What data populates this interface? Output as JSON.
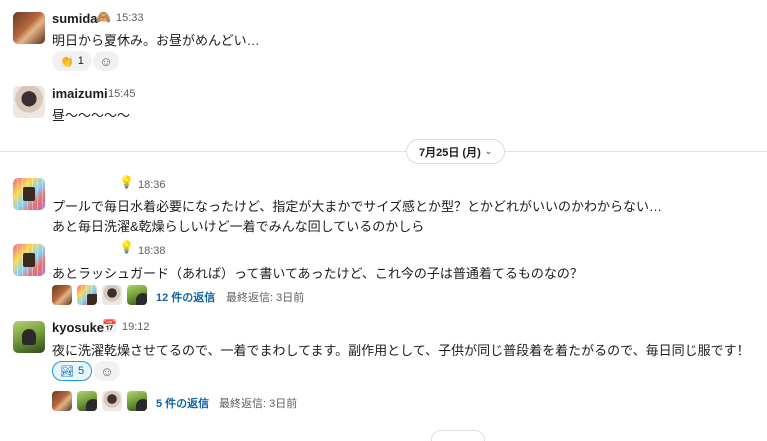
{
  "messages": [
    {
      "user": "sumida",
      "status_emoji": "status-emoji-icon",
      "time": "15:33",
      "text": "明日から夏休み。お昼がめんどい…",
      "reactions": [
        {
          "emoji": "reaction-emoji-icon",
          "count": "1"
        }
      ]
    },
    {
      "user": "imaizumi",
      "time": "15:45",
      "text": "昼〜〜〜〜〜"
    },
    {
      "user": "",
      "status_emoji": "lightbulb-icon",
      "time": "18:36",
      "text_lines": [
        "プールで毎日水着必要になったけど、指定が大まかでサイズ感とか型？とかどれがいいのかわからない…",
        "あと毎日洗濯&乾燥らしいけど一着でみんな回しているのかしら"
      ]
    },
    {
      "user": "",
      "status_emoji": "lightbulb-icon",
      "time": "18:38",
      "text": "あとラッシュガード（あれば）って書いてあったけど、これ今の子は普通着てるものなの？",
      "thread": {
        "replies": "12 件の返信",
        "last_reply": "最終返信: 3日前"
      }
    },
    {
      "user": "kyosuke",
      "status_emoji": "calendar-icon",
      "time": "19:12",
      "text": "夜に洗濯乾燥させてるので、一着でまわしてます。副作用として、子供が同じ普段着を着たがるので、毎日同じ服です！",
      "reactions": [
        {
          "emoji": "reaction-emoji-icon",
          "count": "5"
        }
      ],
      "thread": {
        "replies": "5 件の返信",
        "last_reply": "最終返信: 3日前"
      }
    }
  ],
  "date_divider": {
    "label": "7月25日 (月)"
  }
}
